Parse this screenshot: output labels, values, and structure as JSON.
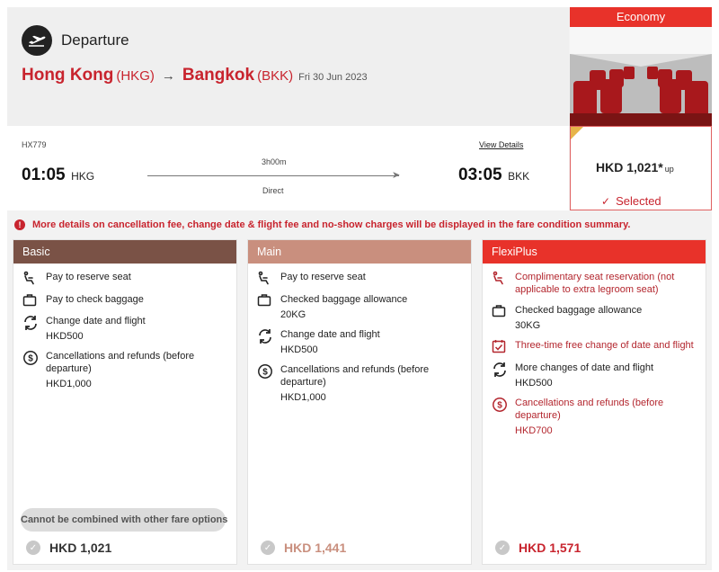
{
  "header": {
    "title": "Departure",
    "origin_city": "Hong Kong",
    "origin_code": "(HKG)",
    "dest_city": "Bangkok",
    "dest_code": "(BKK)",
    "date": "Fri 30 Jun 2023",
    "arrow": "→"
  },
  "cabin": {
    "label": "Economy",
    "price": "HKD 1,021*",
    "price_suffix": "up",
    "selected_label": "Selected",
    "accent_color": "#e8322a"
  },
  "flight": {
    "number": "HX779",
    "view_details": "View Details",
    "departure_time": "01:05",
    "departure_code": "HKG",
    "arrival_time": "03:05",
    "arrival_code": "BKK",
    "duration": "3h00m",
    "type": "Direct"
  },
  "notice": "More details on cancellation fee, change date & flight fee and no-show charges will be displayed in the fare condition summary.",
  "fares": {
    "basic": {
      "name": "Basic",
      "color": "#7a5246",
      "features": [
        {
          "icon": "seat-icon",
          "text": "Pay to reserve seat"
        },
        {
          "icon": "baggage-icon",
          "text": "Pay to check baggage"
        },
        {
          "icon": "change-icon",
          "text": "Change date and flight",
          "sub": "HKD500"
        },
        {
          "icon": "refund-icon",
          "text": "Cancellations and refunds (before departure)",
          "sub": "HKD1,000"
        }
      ],
      "combine_note": "Cannot be combined with other fare options",
      "total": "HKD 1,021",
      "total_color": "#333333"
    },
    "main": {
      "name": "Main",
      "color": "#c98f7e",
      "features": [
        {
          "icon": "seat-icon",
          "text": "Pay to reserve seat"
        },
        {
          "icon": "baggage-icon",
          "text": "Checked baggage allowance",
          "sub": "20KG"
        },
        {
          "icon": "change-icon",
          "text": "Change date and flight",
          "sub": "HKD500"
        },
        {
          "icon": "refund-icon",
          "text": "Cancellations and refunds (before departure)",
          "sub": "HKD1,000"
        }
      ],
      "total": "HKD 1,441",
      "total_color": "#c98f7e"
    },
    "flexiplus": {
      "name": "FlexiPlus",
      "color": "#e8322a",
      "features": [
        {
          "icon": "seat-icon",
          "text": "Complimentary seat reservation (not applicable to extra legroom seat)"
        },
        {
          "icon": "baggage-icon",
          "text": "Checked baggage allowance",
          "sub": "30KG"
        },
        {
          "icon": "calendar-check-icon",
          "text": "Three-time free change of date and flight"
        },
        {
          "icon": "change-icon",
          "text": "More changes of date and flight",
          "sub": "HKD500"
        },
        {
          "icon": "refund-icon",
          "text": "Cancellations and refunds (before departure)",
          "sub": "HKD700"
        }
      ],
      "total": "HKD 1,571",
      "total_color": "#c8242e"
    }
  }
}
